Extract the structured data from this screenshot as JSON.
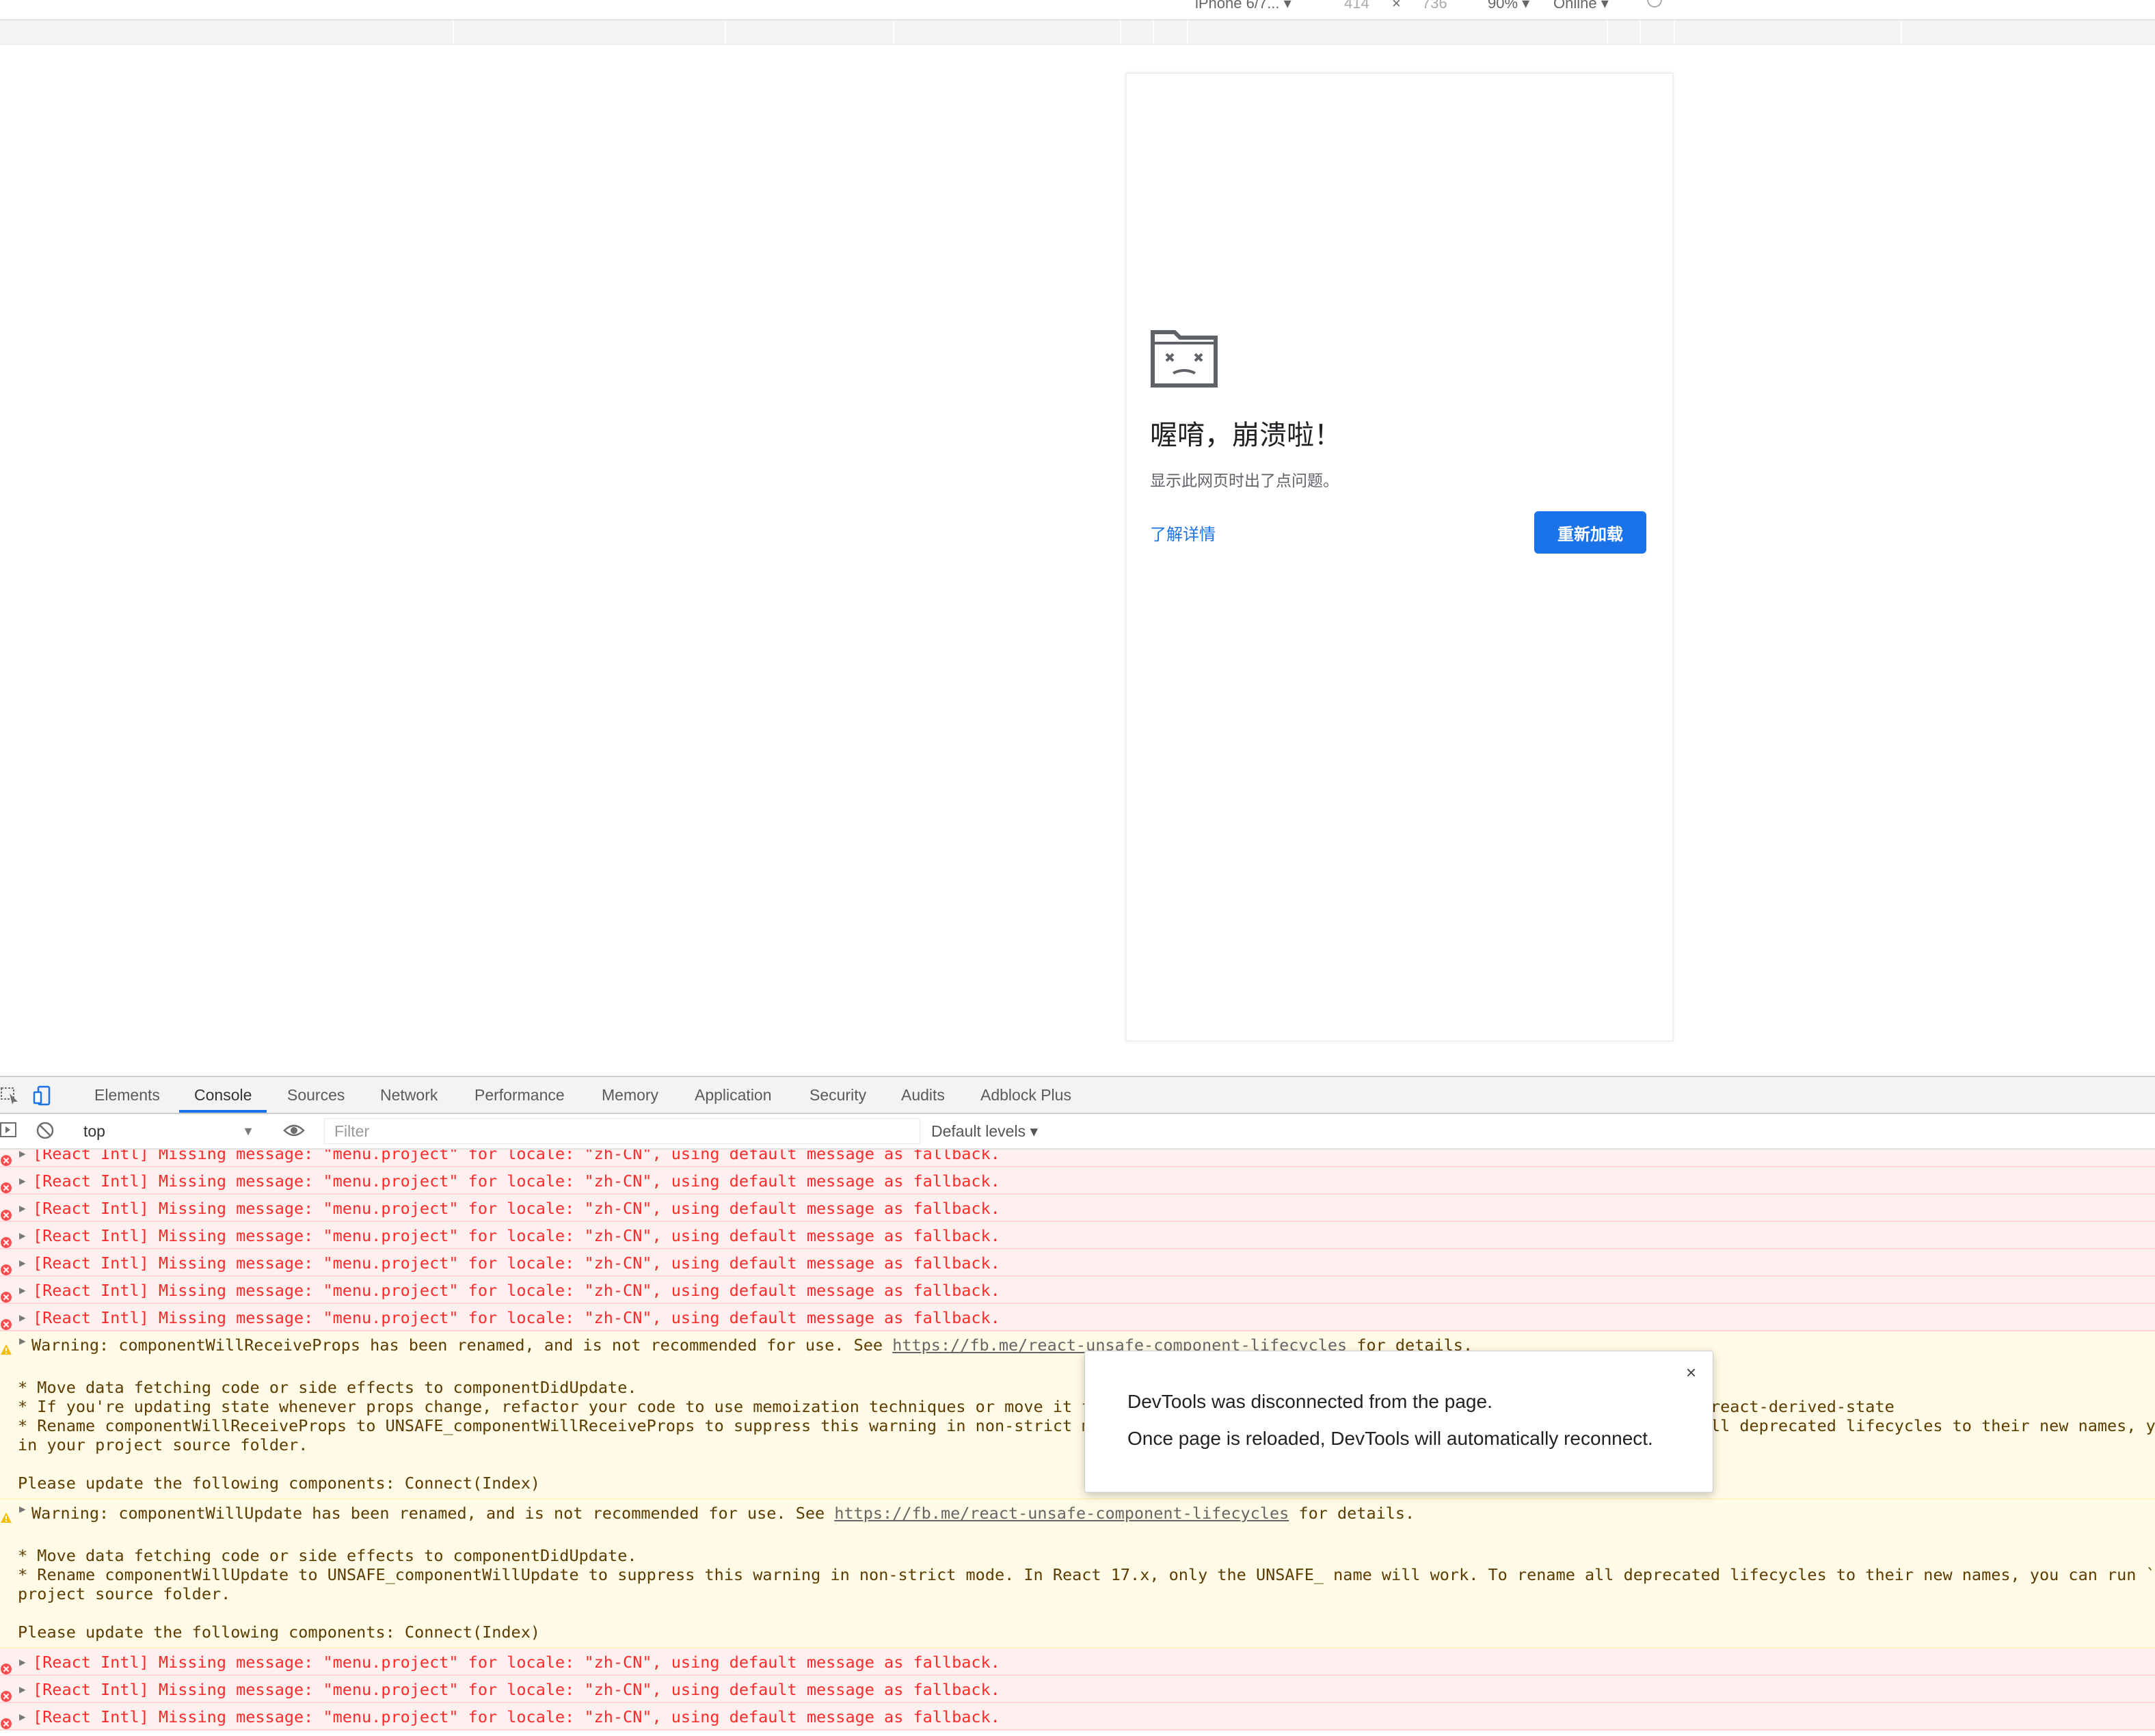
{
  "device_toolbar": {
    "device": "iPhone 6/7...",
    "width": "414",
    "separator": "×",
    "height": "736",
    "zoom": "90%",
    "network": "Online"
  },
  "page": {
    "crash_title": "喔唷，崩溃啦！",
    "crash_subtitle": "显示此网页时出了点问题。",
    "learn_more": "了解详情",
    "reload": "重新加载"
  },
  "devtools": {
    "tabs": [
      "Elements",
      "Console",
      "Sources",
      "Network",
      "Performance",
      "Memory",
      "Application",
      "Security",
      "Audits",
      "Adblock Plus"
    ],
    "active_tab": "Console",
    "context": "top",
    "filter_placeholder": "Filter",
    "levels": "Default levels",
    "error_message": "[React Intl] Missing message: \"menu.project\" for locale: \"zh-CN\", using default message as fallback.",
    "warnings": [
      {
        "head_prefix": "Warning: componentWillReceiveProps has been renamed, and is not recommended for use. See ",
        "link": "https://fb.me/react-unsafe-component-lifecycles",
        "head_suffix": " for details.",
        "lines": [
          "* Move data fetching code or side effects to componentDidUpdate.",
          "* If you're updating state whenever props change, refactor your code to use memoization techniques or move it to static getDerivedStateFromProps. Learn more at: https://fb.me/react-derived-state",
          "* Rename componentWillReceiveProps to UNSAFE_componentWillReceiveProps to suppress this warning in non-strict mode. In React 17.x, only the UNSAFE_ name will work. To rename all deprecated lifecycles to their new names, you can run `npx react-codemod rename-unsafe-lifecycles`",
          "in your project source folder."
        ],
        "footer": "Please update the following components: Connect(Index)"
      },
      {
        "head_prefix": "Warning: componentWillUpdate has been renamed, and is not recommended for use. See ",
        "link": "https://fb.me/react-unsafe-component-lifecycles",
        "head_suffix": " for details.",
        "lines": [
          "* Move data fetching code or side effects to componentDidUpdate.",
          "* Rename componentWillUpdate to UNSAFE_componentWillUpdate to suppress this warning in non-strict mode. In React 17.x, only the UNSAFE_ name will work. To rename all deprecated lifecycles to their new names, you can run `npx react-codemod rename-unsafe-lifecycles` in your",
          "project source folder."
        ],
        "footer": "Please update the following components: Connect(Index)"
      }
    ]
  },
  "dialog": {
    "close": "×",
    "line1": "DevTools was disconnected from the page.",
    "line2": "Once page is reloaded, DevTools will automatically reconnect."
  }
}
